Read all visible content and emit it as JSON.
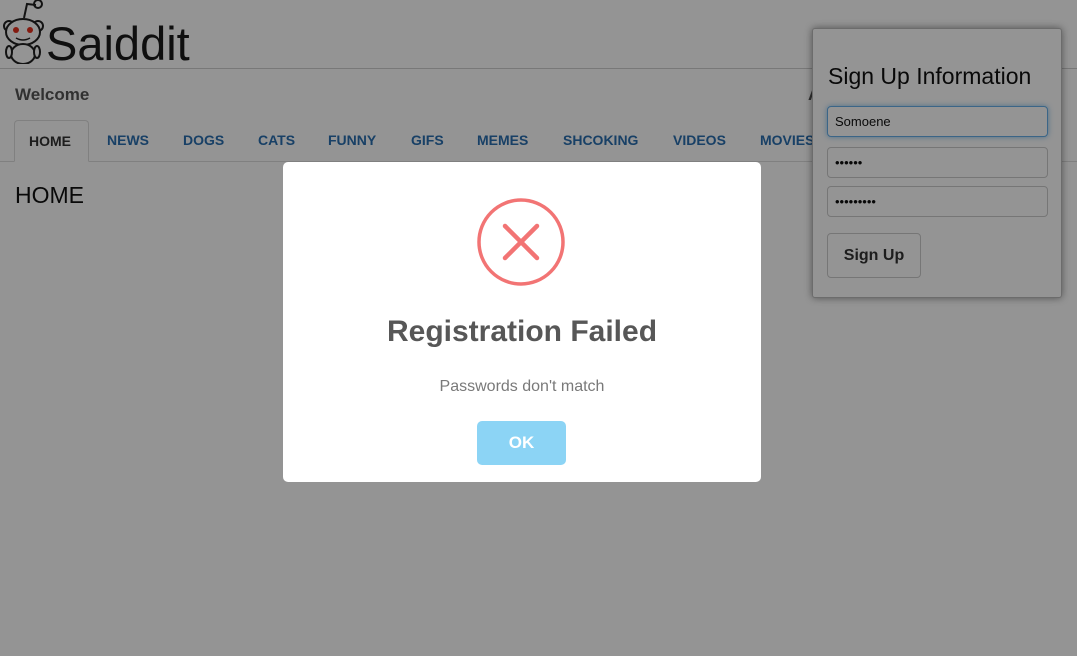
{
  "app": {
    "brand": "Saiddit",
    "logo_icon": "reddit-alien-icon"
  },
  "header": {
    "welcome": "Welcome",
    "right_text": "A"
  },
  "nav": {
    "items": [
      {
        "label": "HOME",
        "active": true
      },
      {
        "label": "NEWS"
      },
      {
        "label": "DOGS"
      },
      {
        "label": "CATS"
      },
      {
        "label": "FUNNY"
      },
      {
        "label": "GIFS"
      },
      {
        "label": "MEMES"
      },
      {
        "label": "SHCOKING"
      },
      {
        "label": "VIDEOS"
      },
      {
        "label": "MOVIES"
      }
    ]
  },
  "page": {
    "heading": "HOME"
  },
  "signup": {
    "title": "Sign Up Information",
    "username_value": "Somoene",
    "password_value": "pass12",
    "confirm_value": "password1",
    "button_label": "Sign Up"
  },
  "modal": {
    "icon": "error-x-icon",
    "title": "Registration Failed",
    "text": "Passwords don't match",
    "ok_label": "OK",
    "colors": {
      "icon": "#f27474",
      "ok_button": "#8cd4f5"
    }
  }
}
